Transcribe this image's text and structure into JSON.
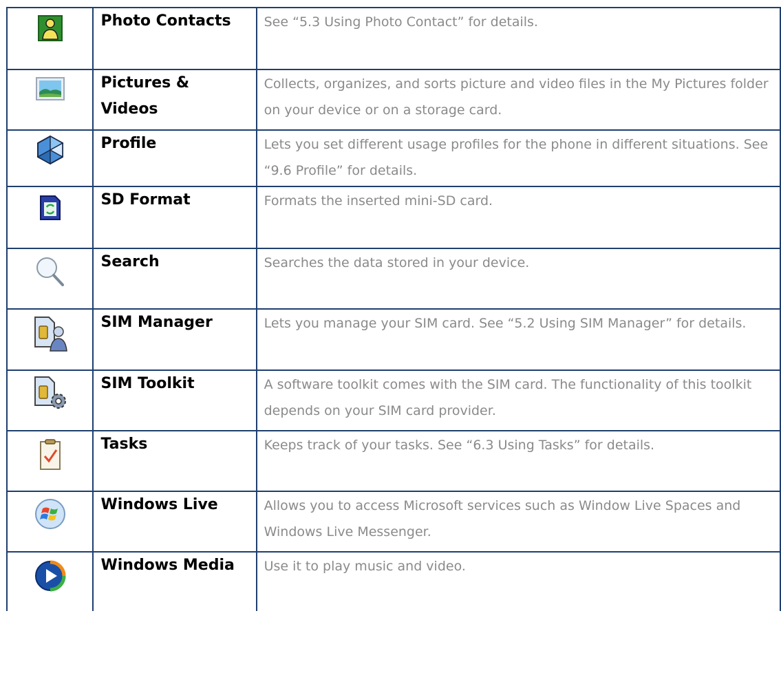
{
  "rows": [
    {
      "name": "Photo Contacts",
      "description": "See “5.3 Using Photo Contact” for details.",
      "icon": "photo-contacts-icon"
    },
    {
      "name": "Pictures &\nVideos",
      "description": "Collects, organizes, and sorts picture and video files in the My Pictures folder on your device or on a storage card.",
      "icon": "pictures-videos-icon"
    },
    {
      "name": "Profile",
      "description": "Lets you set different usage profiles for the phone in different situations. See “9.6 Profile” for details.",
      "icon": "profile-icon"
    },
    {
      "name": "SD Format",
      "description": "Formats the inserted mini-SD card.",
      "icon": "sd-format-icon"
    },
    {
      "name": "Search",
      "description": "Searches the data stored in your device.",
      "icon": "search-icon"
    },
    {
      "name": "SIM Manager",
      "description": "Lets you manage your SIM card. See “5.2 Using SIM Manager” for details.",
      "icon": "sim-manager-icon"
    },
    {
      "name": "SIM Toolkit",
      "description": "A software toolkit comes with the SIM card. The functionality of this toolkit depends on your SIM card provider.",
      "icon": "sim-toolkit-icon"
    },
    {
      "name": "Tasks",
      "description": "Keeps track of your tasks. See “6.3 Using Tasks” for details.",
      "icon": "tasks-icon"
    },
    {
      "name": "Windows Live",
      "description": "Allows you to access Microsoft services such as Window Live Spaces and Windows Live Messenger.",
      "icon": "windows-live-icon"
    },
    {
      "name": "Windows Media",
      "description": "Use it to play music and video.",
      "icon": "windows-media-icon"
    }
  ],
  "colors": {
    "border": "#1e3f6e",
    "description_text": "#8a8a8a"
  }
}
